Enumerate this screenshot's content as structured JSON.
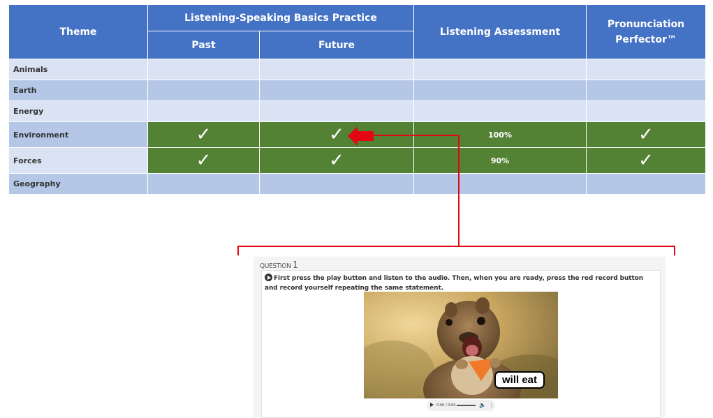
{
  "table": {
    "headers": {
      "theme": "Theme",
      "group": "Listening-Speaking Basics Practice",
      "past": "Past",
      "future": "Future",
      "assessment": "Listening Assessment",
      "perfector": "Pronunciation Perfector™"
    },
    "rows": [
      {
        "topic": "Animals",
        "past": "",
        "future": "",
        "assessment": "",
        "perfector": ""
      },
      {
        "topic": "Earth",
        "past": "",
        "future": "",
        "assessment": "",
        "perfector": ""
      },
      {
        "topic": "Energy",
        "past": "",
        "future": "",
        "assessment": "",
        "perfector": ""
      },
      {
        "topic": "Environment",
        "past": "✓",
        "future": "✓",
        "assessment": "100%",
        "perfector": "✓"
      },
      {
        "topic": "Forces",
        "past": "✓",
        "future": "✓",
        "assessment": "90%",
        "perfector": "✓"
      },
      {
        "topic": "Geography",
        "past": "",
        "future": "",
        "assessment": "",
        "perfector": ""
      }
    ]
  },
  "question": {
    "label": "QUESTION",
    "number": "1",
    "instruction": "First press the play button and listen to the audio. Then, when you are ready, press the red record button and record yourself repeating the same statement.",
    "caption": "will eat",
    "player_time": "0:00 / 0:04"
  },
  "colors": {
    "header": "#4472c4",
    "row_light": "#dae3f3",
    "row_mid": "#b4c7e7",
    "complete": "#548235",
    "arrow": "#e30613"
  },
  "icons": [
    "checkmark-icon",
    "red-arrow-icon",
    "play-circle-icon",
    "volume-icon"
  ]
}
